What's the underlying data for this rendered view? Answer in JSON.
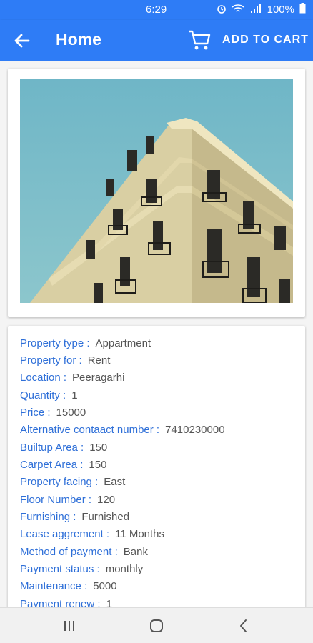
{
  "status": {
    "time": "6:29",
    "battery": "100%"
  },
  "appbar": {
    "title": "Home",
    "add_to_cart": "ADD TO CART"
  },
  "details": [
    {
      "key": "Property type :",
      "value": "Appartment"
    },
    {
      "key": "Property for :",
      "value": "Rent"
    },
    {
      "key": "Location :",
      "value": "Peeragarhi"
    },
    {
      "key": "Quantity :",
      "value": "1"
    },
    {
      "key": "Price :",
      "value": "15000"
    },
    {
      "key": "Alternative contaact number :",
      "value": "7410230000"
    },
    {
      "key": "Builtup Area :",
      "value": "150"
    },
    {
      "key": "Carpet Area :",
      "value": "150"
    },
    {
      "key": "Property facing :",
      "value": "East"
    },
    {
      "key": "Floor Number :",
      "value": "120"
    },
    {
      "key": "Furnishing :",
      "value": "Furnished"
    },
    {
      "key": "Lease aggrement :",
      "value": "11 Months"
    },
    {
      "key": "Method of payment :",
      "value": "Bank"
    },
    {
      "key": "Payment status :",
      "value": "monthly"
    },
    {
      "key": "Maintenance :",
      "value": "5000"
    },
    {
      "key": "Payment renew :",
      "value": "1"
    }
  ],
  "colors": {
    "primary": "#2e7cf6",
    "label": "#2e6fd8",
    "value": "#555555"
  },
  "icons": {
    "back": "arrow-back-icon",
    "cart": "cart-icon",
    "nav_recents": "recents-icon",
    "nav_home": "home-icon",
    "nav_back": "back-icon"
  }
}
